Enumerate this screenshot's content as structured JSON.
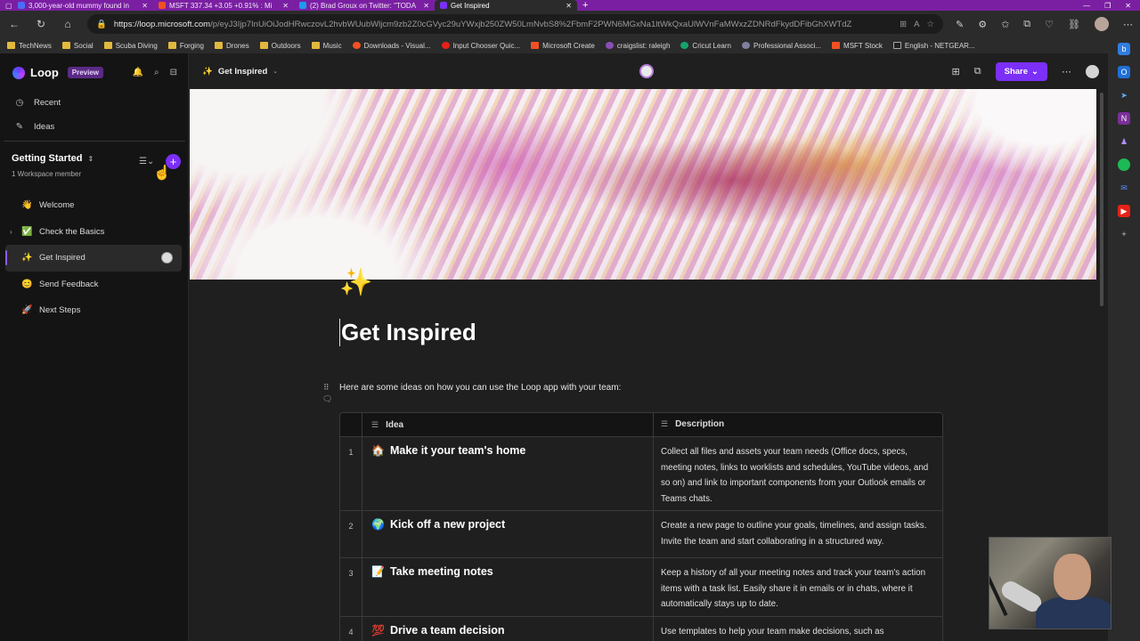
{
  "browser": {
    "tabs": [
      {
        "title": "3,000-year-old mummy found in",
        "color": "#4a6cf7"
      },
      {
        "title": "MSFT 337.34 +3.05 +0.91% : Mi",
        "color": "#f25022"
      },
      {
        "title": "(2) Brad Groux on Twitter: \"TODA",
        "color": "#1d9bf0"
      },
      {
        "title": "Get Inspired",
        "color": "#7b2ff7"
      }
    ],
    "url_host": "https://loop.microsoft.com",
    "url_path": "/p/eyJ3Ijp7InUiOiJodHRwczovL2hvbWUubWljcm9zb2Z0cGVyc29uYWxjb250ZW50LmNvbS8%2FbmF2PWN6MGxNa1ltWkQxaUlWVnFaMWxzZDNRdFkydDFibGhXWTdZ",
    "bookmarks": [
      {
        "label": "TechNews",
        "type": "folder"
      },
      {
        "label": "Social",
        "type": "folder"
      },
      {
        "label": "Scuba Diving",
        "type": "folder"
      },
      {
        "label": "Forging",
        "type": "folder"
      },
      {
        "label": "Drones",
        "type": "folder"
      },
      {
        "label": "Outdoors",
        "type": "folder"
      },
      {
        "label": "Music",
        "type": "folder"
      },
      {
        "label": "Downloads - Visual...",
        "type": "site"
      },
      {
        "label": "Input Chooser Quic...",
        "type": "site"
      },
      {
        "label": "Microsoft Create",
        "type": "site"
      },
      {
        "label": "craigslist: raleigh",
        "type": "site"
      },
      {
        "label": "Cricut Learn",
        "type": "site"
      },
      {
        "label": "Professional Associ...",
        "type": "site"
      },
      {
        "label": "MSFT Stock",
        "type": "site"
      },
      {
        "label": "English - NETGEAR...",
        "type": "site"
      }
    ]
  },
  "app": {
    "name": "Loop",
    "badge": "Preview",
    "nav": [
      {
        "label": "Recent",
        "icon": "clock-icon",
        "glyph": "◷"
      },
      {
        "label": "Ideas",
        "icon": "pen-icon",
        "glyph": "✎"
      }
    ],
    "workspace": {
      "title": "Getting Started",
      "members": "1 Workspace member"
    },
    "pages": [
      {
        "label": "Welcome",
        "emoji": "👋",
        "active": false,
        "expandable": false
      },
      {
        "label": "Check the Basics",
        "emoji": "✅",
        "active": false,
        "expandable": true
      },
      {
        "label": "Get Inspired",
        "emoji": "✨",
        "active": true,
        "expandable": false
      },
      {
        "label": "Send Feedback",
        "emoji": "😊",
        "active": false,
        "expandable": false
      },
      {
        "label": "Next Steps",
        "emoji": "🚀",
        "active": false,
        "expandable": false
      }
    ]
  },
  "header": {
    "breadcrumb": "Get Inspired",
    "share_label": "Share"
  },
  "doc": {
    "emoji": "✨",
    "title": "Get Inspired",
    "intro": "Here are some ideas on how you can use the Loop app with your team:",
    "table": {
      "headers": [
        "Idea",
        "Description"
      ],
      "rows": [
        {
          "num": "1",
          "emoji": "🏠",
          "idea": "Make it your team's home",
          "desc": "Collect all files and assets your team needs (Office docs, specs, meeting notes, links to worklists and schedules, YouTube videos, and so on) and link to important components from your Outlook emails or Teams chats."
        },
        {
          "num": "2",
          "emoji": "🌍",
          "idea": "Kick off a new project",
          "desc": "Create a new page to outline your goals, timelines, and assign tasks. Invite the team and start collaborating in a structured way."
        },
        {
          "num": "3",
          "emoji": "📝",
          "idea": "Take meeting notes",
          "desc": "Keep a history of all your meeting notes and track your team's action items with a task list. Easily share it in emails or in chats, where it automatically stays up to date."
        },
        {
          "num": "4",
          "emoji": "💯",
          "idea": "Drive a team decision",
          "desc": "Use templates to help your team make decisions, such as"
        }
      ]
    }
  },
  "colors": {
    "accent": "#7b2ff7",
    "tab_strip": "#7a1fa2",
    "sidebar_bg": "#141414",
    "canvas_bg": "#1f1f1f"
  }
}
